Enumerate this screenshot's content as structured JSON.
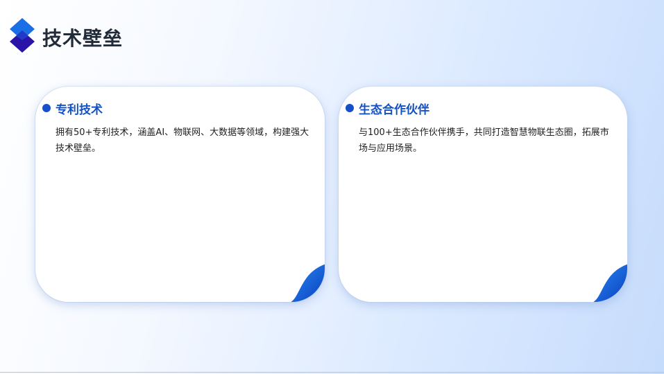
{
  "page": {
    "title": "技术壁垒"
  },
  "cards": [
    {
      "title": "专利技术",
      "body": "拥有50+专利技术，涵盖AI、物联网、大数据等领域，构建强大技术壁垒。"
    },
    {
      "title": "生态合作伙伴",
      "body": "与100+生态合作伙伴携手，共同打造智慧物联生态圈，拓展市场与应用场景。"
    }
  ],
  "colors": {
    "accent": "#1450c8",
    "logo_top": "#1a6fe6",
    "logo_bottom": "#2a14a8",
    "title_text": "#222b38",
    "card_title": "#1451c2"
  },
  "icons": {
    "logo": "stacked-diamonds-icon",
    "bullet": "dot-icon",
    "corner": "page-curl-icon"
  }
}
